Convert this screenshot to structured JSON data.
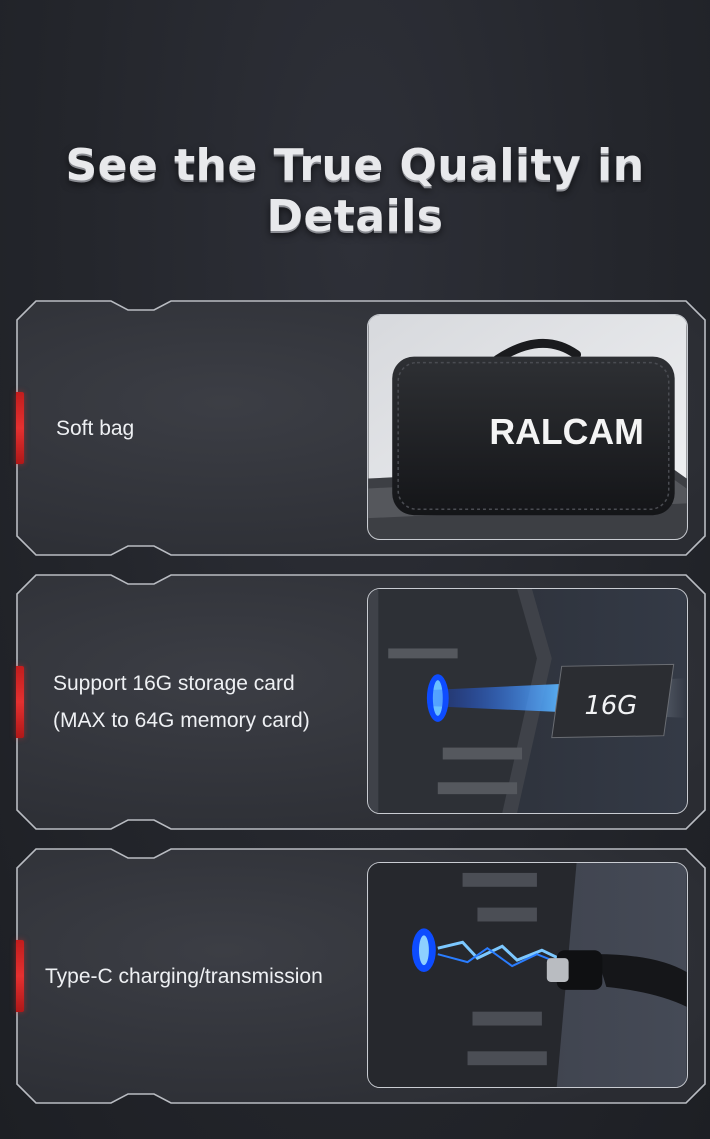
{
  "headline": "See the True Quality in Details",
  "features": [
    {
      "lines": [
        "Soft bag"
      ],
      "image": "carrying-case-photo",
      "brand": "RALCAM"
    },
    {
      "lines": [
        "Support 16G storage card",
        "(MAX to 64G memory card)"
      ],
      "image": "memory-card-slot-photo",
      "card_label": "16G"
    },
    {
      "lines": [
        "Type-C charging/transmission"
      ],
      "image": "usb-c-port-photo"
    }
  ],
  "colors": {
    "accent": "#e02626",
    "background": "#25272c",
    "text": "#eef0f3"
  }
}
